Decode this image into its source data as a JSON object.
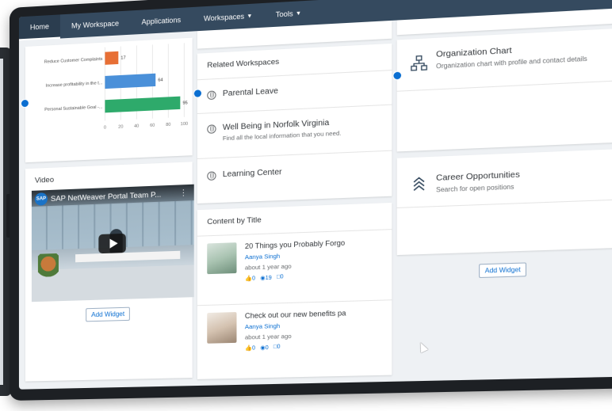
{
  "nav": {
    "items": [
      {
        "label": "Home"
      },
      {
        "label": "My Workspace"
      },
      {
        "label": "Applications"
      },
      {
        "label": "Workspaces"
      },
      {
        "label": "Tools"
      }
    ]
  },
  "chart_data": {
    "type": "bar",
    "orientation": "horizontal",
    "categories": [
      "Reduce Customer Complaints",
      "Increase profitability in the t...",
      "Personal Sustainable Goal -..."
    ],
    "values": [
      17,
      64,
      95
    ],
    "data_labels": [
      "17",
      "64",
      "95"
    ],
    "colors": [
      "#e76f35",
      "#4a90d9",
      "#2eaa6b"
    ],
    "xlim": [
      0,
      100
    ],
    "xticks": [
      "0",
      "20",
      "40",
      "60",
      "80",
      "100"
    ],
    "grid": true
  },
  "video_card": {
    "title": "Video",
    "video_title": "SAP NetWeaver Portal Team P...",
    "logo_text": "SAP",
    "add_widget": "Add Widget"
  },
  "related": {
    "title": "Related Workspaces",
    "items": [
      {
        "label": "Parental Leave",
        "sub": ""
      },
      {
        "label": "Well Being in Norfolk Virginia",
        "sub": "Find all the local information that you need."
      },
      {
        "label": "Learning Center",
        "sub": ""
      }
    ]
  },
  "content": {
    "title": "Content by Title",
    "items": [
      {
        "title": "20 Things you Probably Forgo",
        "author": "Aanya Singh",
        "time": "about 1 year ago",
        "likes": "0",
        "views": "19",
        "comments": "0"
      },
      {
        "title": "Check out our new benefits pa",
        "author": "Aanya Singh",
        "time": "about 1 year ago",
        "likes": "0",
        "views": "0",
        "comments": "0"
      }
    ]
  },
  "tiles": {
    "org": {
      "title": "Organization Chart",
      "sub": "Organization chart with profile and contact details",
      "icon": "org-chart-icon"
    },
    "career": {
      "title": "Career Opportunities",
      "sub": "Search for open positions",
      "icon": "chevrons-up-icon"
    },
    "add_widget": "Add Widget"
  },
  "colors": {
    "nav_bg": "#354a5f",
    "accent": "#0a6ed1"
  }
}
